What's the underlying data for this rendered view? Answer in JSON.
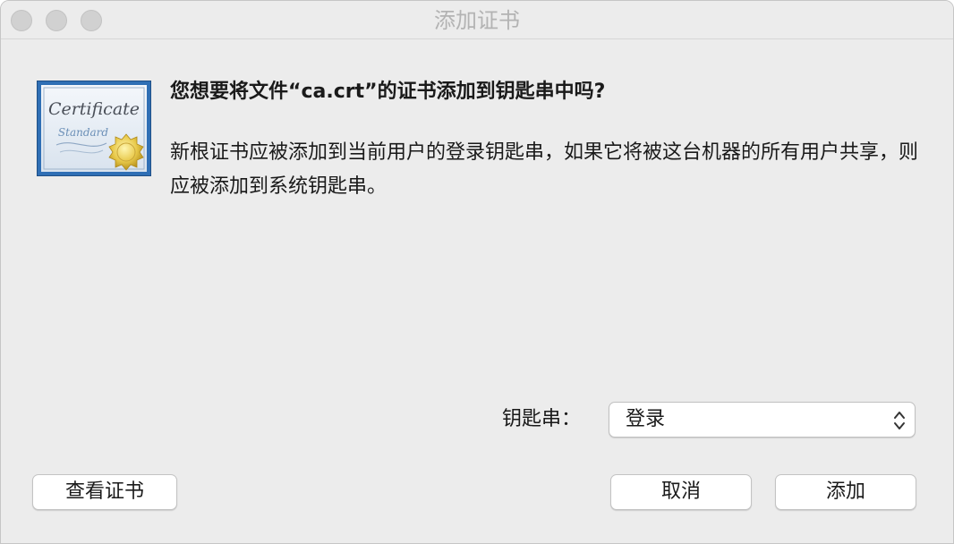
{
  "window": {
    "title": "添加证书"
  },
  "icon": {
    "name": "certificate-icon",
    "text_line1": "Certificate",
    "text_line2": "Standard"
  },
  "message": {
    "heading": "您想要将文件“ca.crt”的证书添加到钥匙串中吗?",
    "body": "新根证书应被添加到当前用户的登录钥匙串，如果它将被这台机器的所有用户共享，则应被添加到系统钥匙串。"
  },
  "keychain": {
    "label": "钥匙串：",
    "selected": "登录"
  },
  "buttons": {
    "view_certificate": "查看证书",
    "cancel": "取消",
    "add": "添加"
  }
}
